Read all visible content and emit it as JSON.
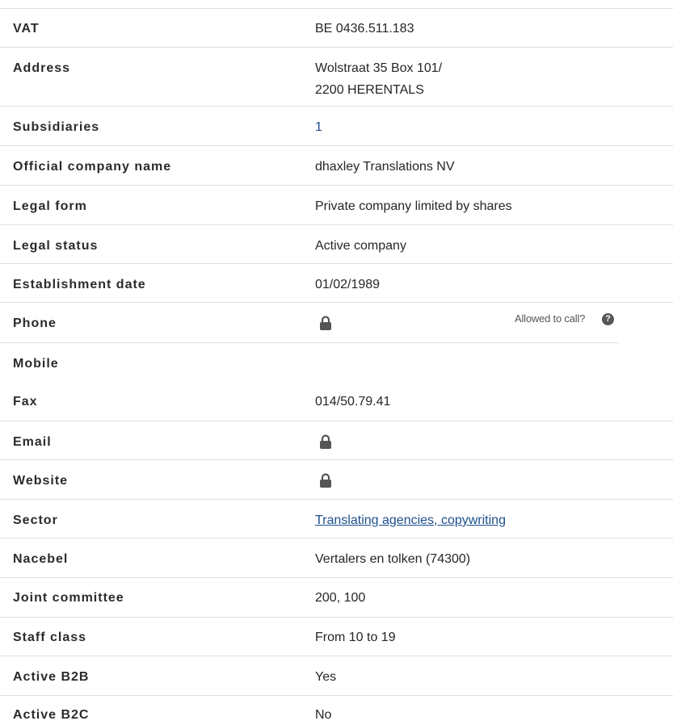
{
  "rows": [
    {
      "label": "VAT",
      "value": "BE 0436.511.183"
    },
    {
      "label": "Address",
      "value_line1": "Wolstraat 35 Box 101/",
      "value_line2": "2200 HERENTALS"
    },
    {
      "label": "Subsidiaries",
      "value": "1"
    },
    {
      "label": "Official company name",
      "value": "dhaxley Translations NV"
    },
    {
      "label": "Legal form",
      "value": "Private company limited by shares"
    },
    {
      "label": "Legal status",
      "value": "Active company"
    },
    {
      "label": "Establishment date",
      "value": "01/02/1989"
    },
    {
      "label": "Phone",
      "value_icon": "lock-icon",
      "allowed_to_call": "Allowed to call?",
      "help_icon": "question-circle-icon"
    },
    {
      "label": "Mobile",
      "value": ""
    },
    {
      "label": "Fax",
      "value": "014/50.79.41"
    },
    {
      "label": "Email",
      "value_icon": "lock-icon"
    },
    {
      "label": "Website",
      "value_icon": "lock-icon"
    },
    {
      "label": "Sector",
      "value": "Translating agencies, copywriting"
    },
    {
      "label": "Nacebel",
      "value": "Vertalers en tolken (74300)"
    },
    {
      "label": "Joint committee",
      "value": "200, 100"
    },
    {
      "label": "Staff class",
      "value": "From 10 to 19"
    },
    {
      "label": "Active B2B",
      "value": "Yes"
    },
    {
      "label": "Active B2C",
      "value": "No"
    }
  ],
  "colors": {
    "link": "#1d4f8c",
    "rule": "#dedede",
    "icon": "#555555"
  }
}
